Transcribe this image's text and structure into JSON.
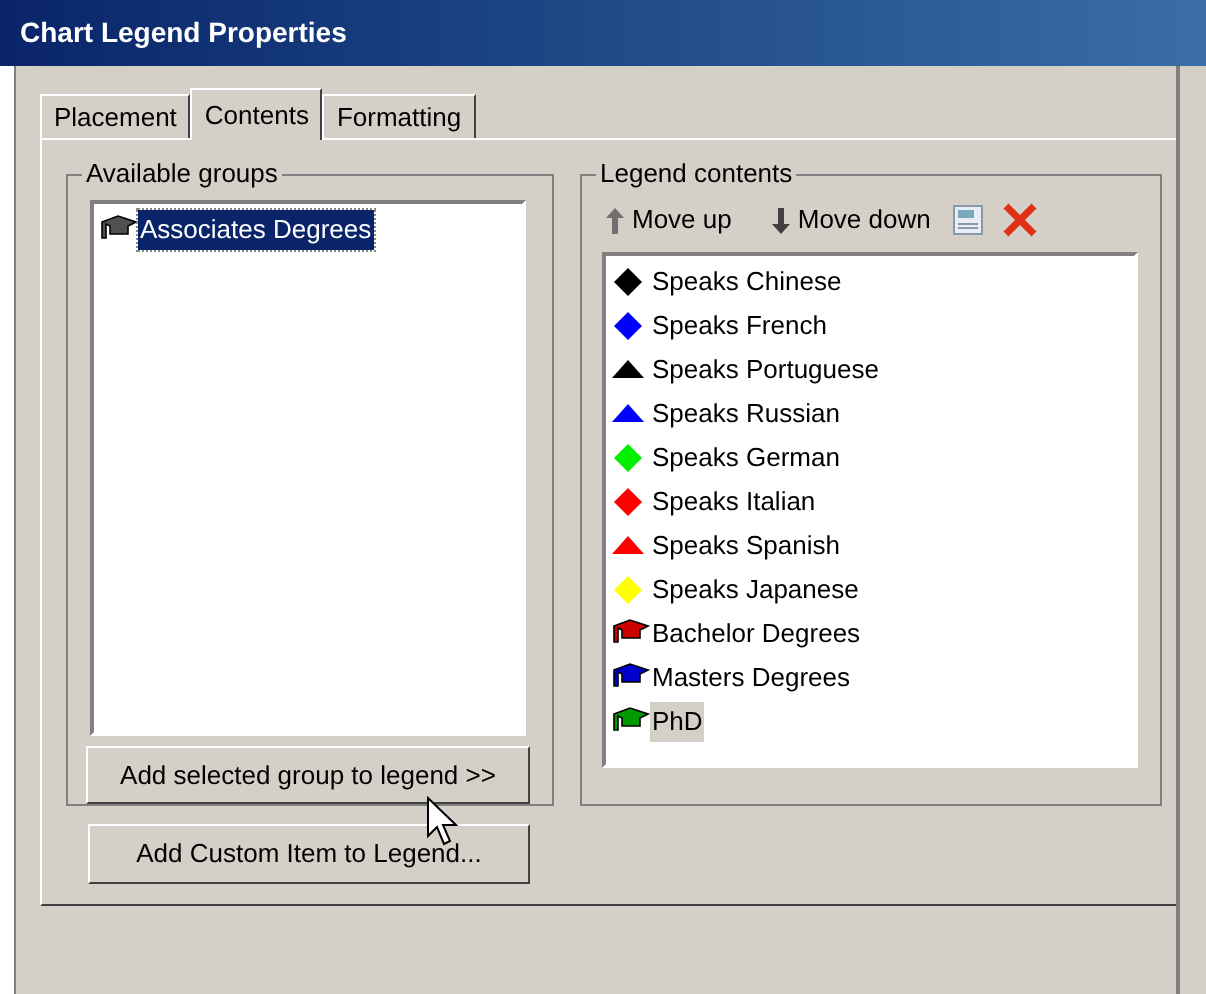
{
  "window": {
    "title": "Chart Legend Properties"
  },
  "tabs": [
    {
      "label": "Placement",
      "selected": false
    },
    {
      "label": "Contents",
      "selected": true
    },
    {
      "label": "Formatting",
      "selected": false
    }
  ],
  "available_groups": {
    "title": "Available groups",
    "items": [
      {
        "label": "Associates Degrees",
        "kind": "cap",
        "color": "#505050",
        "selected": true
      }
    ],
    "add_button": "Add selected group to legend >>"
  },
  "legend_contents": {
    "title": "Legend contents",
    "move_up": "Move up",
    "move_down": "Move down",
    "items": [
      {
        "label": "Speaks Chinese",
        "kind": "diamond",
        "color": "#000000",
        "selected": false
      },
      {
        "label": "Speaks French",
        "kind": "diamond",
        "color": "#0000ff",
        "selected": false
      },
      {
        "label": "Speaks Portuguese",
        "kind": "triangle",
        "color": "#000000",
        "selected": false
      },
      {
        "label": "Speaks Russian",
        "kind": "triangle",
        "color": "#0000ff",
        "selected": false
      },
      {
        "label": "Speaks German",
        "kind": "diamond",
        "color": "#00ee00",
        "selected": false
      },
      {
        "label": "Speaks Italian",
        "kind": "diamond",
        "color": "#ff0000",
        "selected": false
      },
      {
        "label": "Speaks Spanish",
        "kind": "triangle",
        "color": "#ff0000",
        "selected": false
      },
      {
        "label": "Speaks Japanese",
        "kind": "diamond",
        "color": "#ffff00",
        "selected": false
      },
      {
        "label": "Bachelor Degrees",
        "kind": "cap",
        "color": "#cc0000",
        "selected": false
      },
      {
        "label": "Masters Degrees",
        "kind": "cap",
        "color": "#0000cc",
        "selected": false
      },
      {
        "label": "PhD",
        "kind": "cap",
        "color": "#009900",
        "selected": true
      }
    ]
  },
  "custom_button": "Add Custom Item to Legend..."
}
